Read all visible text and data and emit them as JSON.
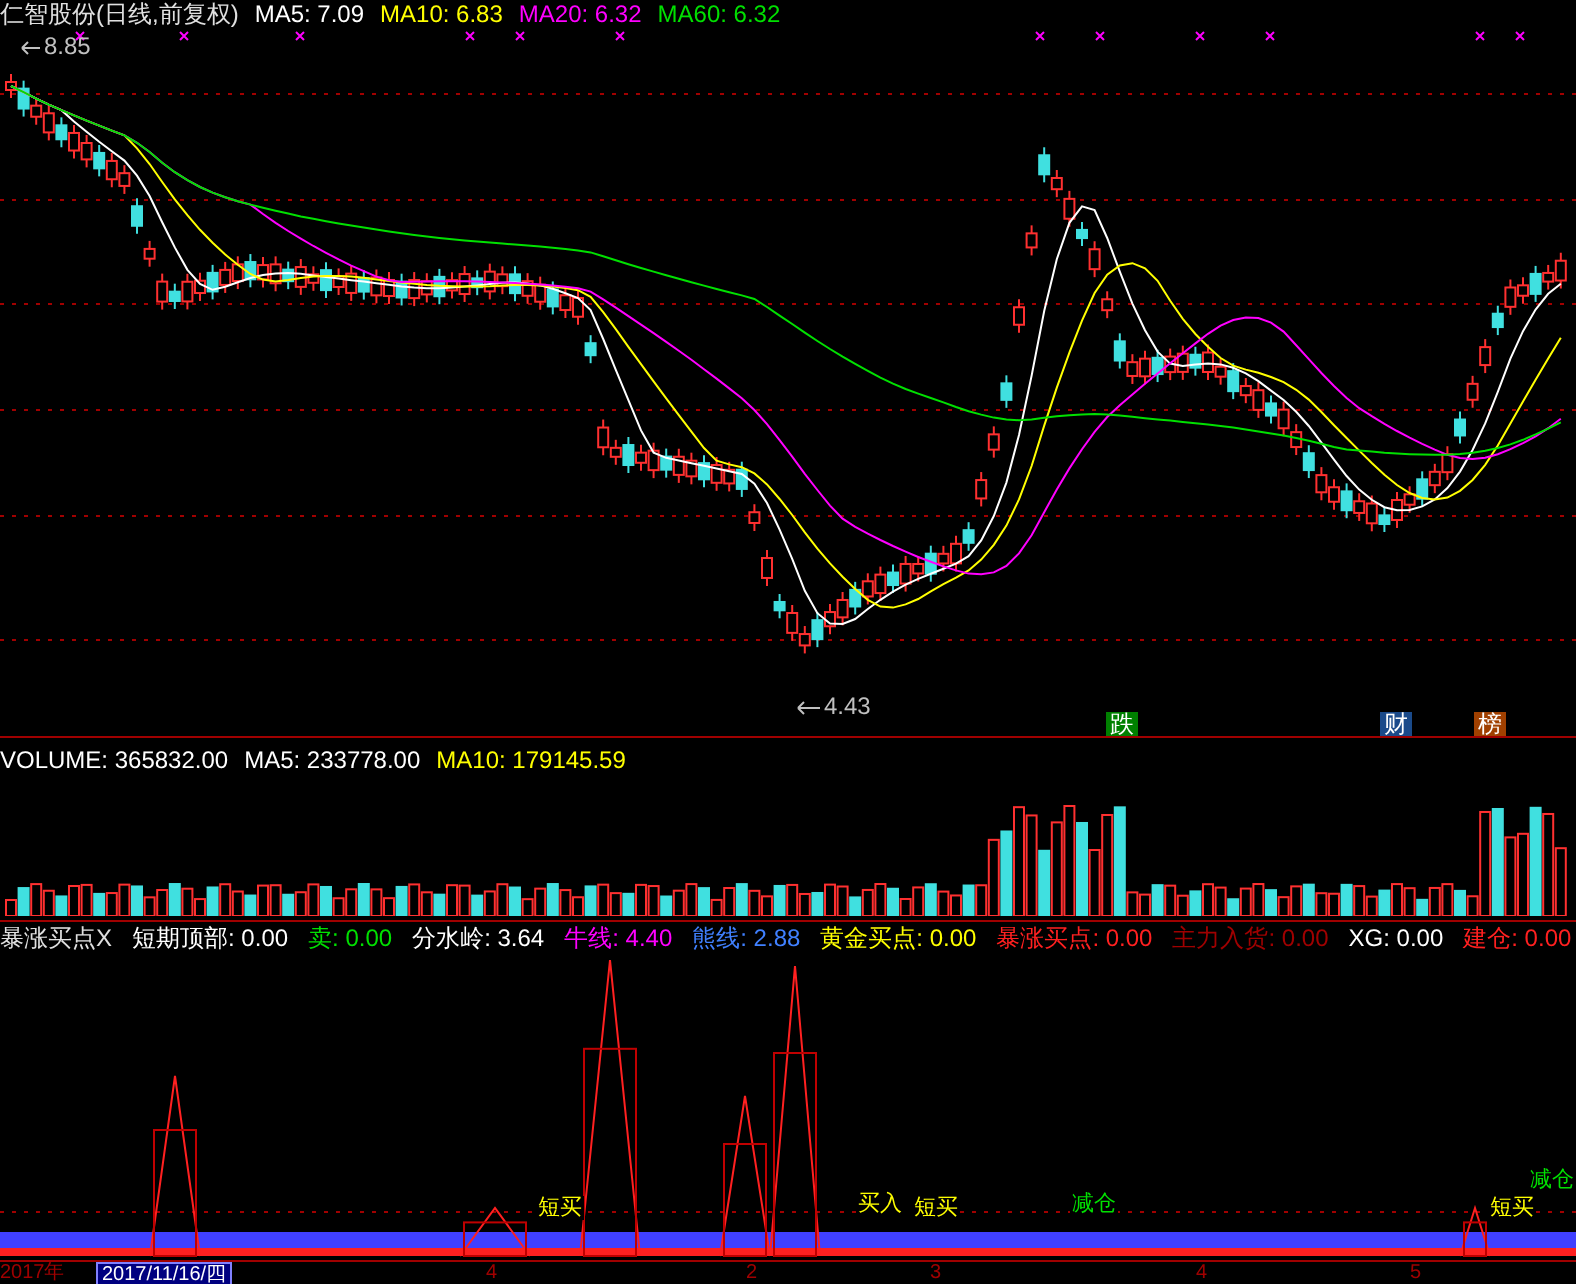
{
  "header": {
    "title": "仁智股份(日线,前复权)",
    "ma": [
      {
        "label": "MA5: 7.09",
        "color": "#ffffff"
      },
      {
        "label": "MA10: 6.83",
        "color": "#ffff00"
      },
      {
        "label": "MA20: 6.32",
        "color": "#ff00ff"
      },
      {
        "label": "MA60: 6.32",
        "color": "#00e000"
      }
    ]
  },
  "price_marks": {
    "high": "8.85",
    "low": "4.43"
  },
  "event_badges": [
    {
      "text": "跌",
      "color": "#008000"
    },
    {
      "text": "财",
      "color": "#1a4a8a"
    },
    {
      "text": "榜",
      "color": "#a04000"
    }
  ],
  "volume": {
    "items": [
      {
        "label": "VOLUME: 365832.00",
        "color": "#ffffff"
      },
      {
        "label": "MA5: 233778.00",
        "color": "#ffffff"
      },
      {
        "label": "MA10: 179145.59",
        "color": "#ffff00"
      }
    ]
  },
  "indicator": {
    "title": "暴涨买点X",
    "items": [
      {
        "label": "短期顶部: 0.00",
        "color": "#ffffff"
      },
      {
        "label": "卖: 0.00",
        "color": "#00e000"
      },
      {
        "label": "分水岭: 3.64",
        "color": "#ffffff"
      },
      {
        "label": "牛线: 4.40",
        "color": "#ff00ff"
      },
      {
        "label": "熊线: 2.88",
        "color": "#4080ff"
      },
      {
        "label": "黄金买点: 0.00",
        "color": "#ffff00"
      },
      {
        "label": "暴涨买点: 0.00",
        "color": "#ff2020"
      },
      {
        "label": "主力入货: 0.00",
        "color": "#a00000"
      },
      {
        "label": "XG: 0.00",
        "color": "#ffffff"
      },
      {
        "label": "建仓: 0.00",
        "color": "#ff2020"
      }
    ]
  },
  "signals": [
    {
      "text": "短买",
      "color": "#ffff00"
    },
    {
      "text": "买入",
      "color": "#ffff00"
    },
    {
      "text": "短买",
      "color": "#ffff00"
    },
    {
      "text": "减仓",
      "color": "#00e000"
    },
    {
      "text": "短买",
      "color": "#ffff00"
    },
    {
      "text": "减仓",
      "color": "#00e000"
    }
  ],
  "axis": {
    "year": "2017年",
    "date": "2017/11/16/四",
    "months": [
      "4",
      "2",
      "3",
      "4",
      "5"
    ]
  }
}
